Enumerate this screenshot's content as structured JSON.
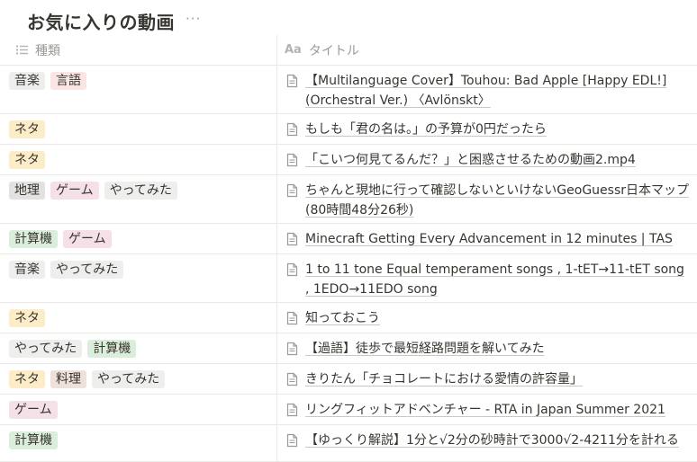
{
  "page": {
    "title": "お気に入りの動画",
    "more": "···"
  },
  "columns": {
    "tags": "種類",
    "title_icon": "Aa",
    "title": "タイトル"
  },
  "tag_colors": {
    "音楽": {
      "bg": "#eeeeec",
      "fg": "#37352f"
    },
    "言語": {
      "bg": "#fbe4e4",
      "fg": "#37352f"
    },
    "ネタ": {
      "bg": "#fdecc8",
      "fg": "#37352f"
    },
    "地理": {
      "bg": "#e3e2e0",
      "fg": "#37352f"
    },
    "ゲーム": {
      "bg": "#f5e0e9",
      "fg": "#37352f"
    },
    "やってみた": {
      "bg": "#eeeeec",
      "fg": "#37352f"
    },
    "計算機": {
      "bg": "#dbeddb",
      "fg": "#37352f"
    },
    "料理": {
      "bg": "#eee0da",
      "fg": "#37352f"
    }
  },
  "rows": [
    {
      "tags": [
        "音楽",
        "言語"
      ],
      "title": "【Multilanguage Cover】Touhou: Bad Apple [Happy EDL!] (Orchestral Ver.) 〈Avlönskt〉"
    },
    {
      "tags": [
        "ネタ"
      ],
      "title": "もしも「君の名は。」の予算が0円だったら"
    },
    {
      "tags": [
        "ネタ"
      ],
      "title": "「こいつ何見てるんだ？」と困惑させるための動画2.mp4"
    },
    {
      "tags": [
        "地理",
        "ゲーム",
        "やってみた"
      ],
      "title": "ちゃんと現地に行って確認しないといけないGeoGuessr日本マップ(80時間48分26秒)"
    },
    {
      "tags": [
        "計算機",
        "ゲーム"
      ],
      "title": "Minecraft Getting Every Advancement in 12 minutes | TAS"
    },
    {
      "tags": [
        "音楽",
        "やってみた"
      ],
      "title": "1 to 11 tone Equal temperament songs , 1-tET→11-tET song , 1EDO→11EDO song"
    },
    {
      "tags": [
        "ネタ"
      ],
      "title": "知っておこう"
    },
    {
      "tags": [
        "やってみた",
        "計算機"
      ],
      "title": "【過語】徒歩で最短経路問題を解いてみた"
    },
    {
      "tags": [
        "ネタ",
        "料理",
        "やってみた"
      ],
      "title": "きりたん「チョコレートにおける愛情の許容量」"
    },
    {
      "tags": [
        "ゲーム"
      ],
      "title": "リングフィットアドベンチャー - RTA in Japan Summer 2021"
    },
    {
      "tags": [
        "計算機"
      ],
      "title": "【ゆっくり解説】1分と√2分の砂時計で3000√2-4211分を計れる"
    }
  ]
}
